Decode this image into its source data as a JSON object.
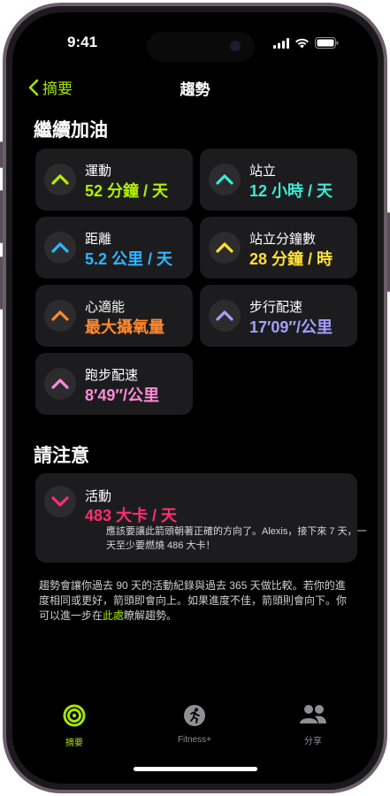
{
  "status": {
    "time": "9:41"
  },
  "nav": {
    "back_label": "摘要",
    "title": "趨勢"
  },
  "keep_going": {
    "title": "繼續加油",
    "cards": [
      {
        "label": "運動",
        "value": "52 分鐘 / 天",
        "color": "#b4f000"
      },
      {
        "label": "站立",
        "value": "12 小時 / 天",
        "color": "#3ee8d4"
      },
      {
        "label": "距離",
        "value": "5.2 公里 / 天",
        "color": "#2fb6ff"
      },
      {
        "label": "站立分鐘數",
        "value": "28 分鐘 / 時",
        "color": "#ffe034"
      },
      {
        "label": "心適能",
        "value": "最大攝氧量",
        "color": "#ff8a2f"
      },
      {
        "label": "步行配速",
        "value": "17′09″/公里",
        "color": "#a89cff"
      },
      {
        "label": "跑步配速",
        "value": "8′49″/公里",
        "color": "#ff8ad8"
      }
    ]
  },
  "attention": {
    "title": "請注意",
    "card": {
      "label": "活動",
      "value": "483 大卡 / 天",
      "color": "#ff2d6f",
      "message": "應該要讓此箭頭朝著正確的方向了。Alexis，接下來 7 天，一天至少要燃燒 486 大卡！"
    }
  },
  "footnote": {
    "text_before": "趨勢會讓你過去 90 天的活動紀錄與過去 365 天做比較。若你的進度相同或更好，箭頭即會向上。如果進度不佳，箭頭則會向下。你可以進一步在",
    "link": "此處",
    "text_after": "瞭解趨勢。"
  },
  "tabbar": {
    "items": [
      {
        "label": "摘要",
        "icon": "activity-rings-icon",
        "active": true
      },
      {
        "label": "Fitness+",
        "icon": "fitness-plus-icon",
        "active": false
      },
      {
        "label": "分享",
        "icon": "sharing-people-icon",
        "active": false
      }
    ]
  },
  "colors": {
    "accent": "#a8e600",
    "background": "#000000",
    "card": "#1c1c1e"
  }
}
